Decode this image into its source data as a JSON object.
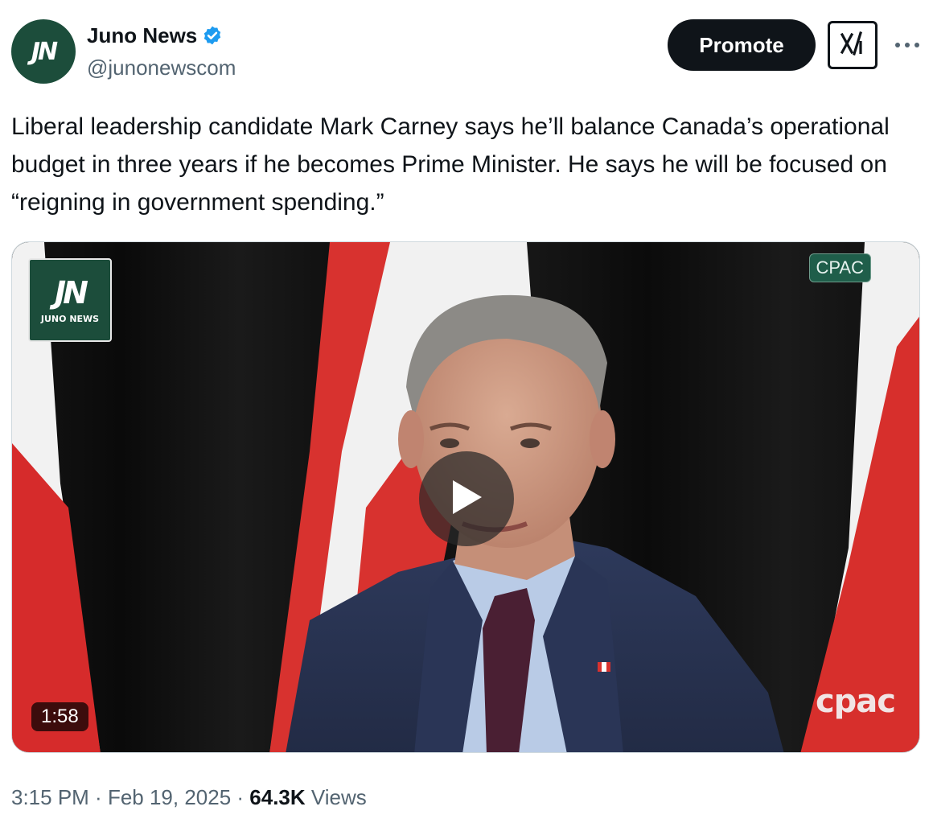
{
  "author": {
    "name": "Juno News",
    "handle": "@junonewscom",
    "avatar_logo": "JN",
    "verified_icon": "verified-badge-icon",
    "verified_color": "#1d9bf0",
    "avatar_color": "#1c4d3b"
  },
  "actions": {
    "promote_label": "Promote",
    "grok_icon": "grok-icon",
    "more_icon": "more-dots-icon"
  },
  "tweet": {
    "text": "Liberal leadership candidate Mark Carney says he’ll balance Canada’s operational budget in three years if he becomes Prime Minister. He says he will be focused on “reigning in government spending.”"
  },
  "media": {
    "watermark_mark": "JN",
    "watermark_word": "JUNO NEWS",
    "cpac_badge": "CPAC",
    "cpac_logo": "cpac",
    "duration": "1:58",
    "play_icon": "play-icon"
  },
  "meta": {
    "time": "3:15 PM",
    "separator": " · ",
    "date": "Feb 19, 2025",
    "views_count": "64.3K",
    "views_label": " Views"
  }
}
